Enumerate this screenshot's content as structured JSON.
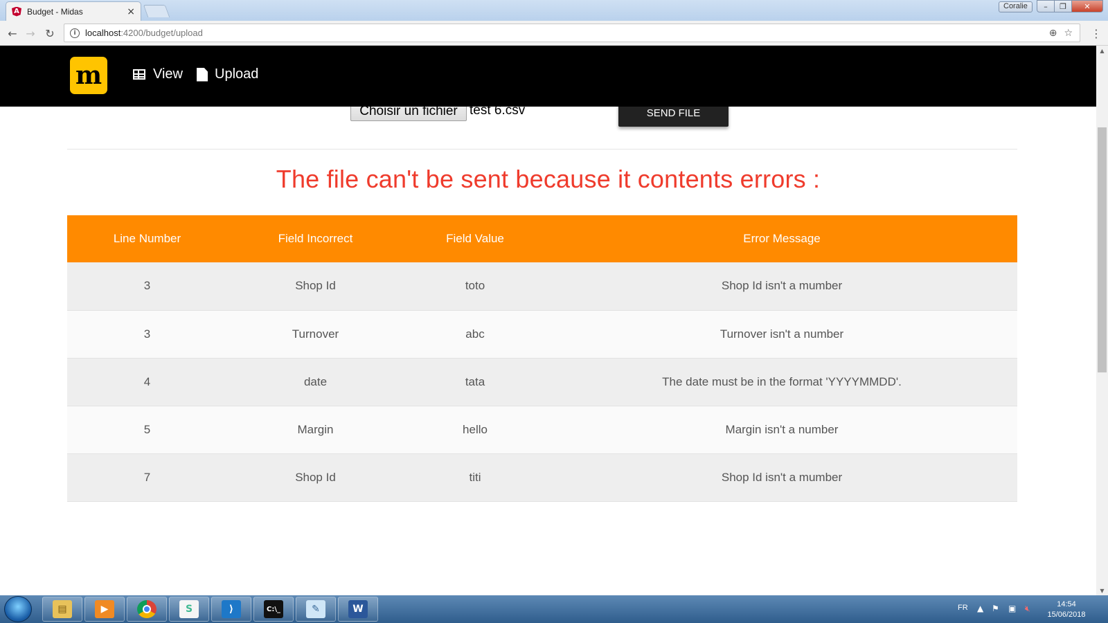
{
  "browser": {
    "tab_title": "Budget - Midas",
    "tab_favicon": "angular-icon",
    "tab_close": "×",
    "window_user": "Coralie",
    "url_host": "localhost",
    "url_path": ":4200/budget/upload",
    "back_glyph": "←",
    "forward_glyph": "→",
    "reload_glyph": "↻",
    "zoom_glyph": "⊕",
    "star_glyph": "☆",
    "menu_glyph": "⋮",
    "min_glyph": "–",
    "max_glyph": "❐",
    "close_glyph": "✕"
  },
  "navbar": {
    "logo_letter": "m",
    "view_label": "View",
    "upload_label": "Upload"
  },
  "upload": {
    "choose_file_label": "Choisir un fichier",
    "file_name": "test 6.csv",
    "send_label": "SEND FILE"
  },
  "error_title": "The file can't be sent because it contents errors :",
  "table": {
    "headers": [
      "Line Number",
      "Field Incorrect",
      "Field Value",
      "Error Message"
    ],
    "rows": [
      [
        "3",
        "Shop Id",
        "toto",
        "Shop Id isn't a mumber"
      ],
      [
        "3",
        "Turnover",
        "abc",
        "Turnover isn't a number"
      ],
      [
        "4",
        "date",
        "tata",
        "The date must be in the format 'YYYYMMDD'."
      ],
      [
        "5",
        "Margin",
        "hello",
        "Margin isn't a number"
      ],
      [
        "7",
        "Shop Id",
        "titi",
        "Shop Id isn't a mumber"
      ]
    ]
  },
  "colors": {
    "navbar_bg": "#000000",
    "brand_yellow": "#ffc400",
    "table_header": "#ff8a00",
    "error_text": "#ef3b2c",
    "send_button": "#222222"
  },
  "taskbar": {
    "apps": [
      "file-explorer-icon",
      "media-player-icon",
      "chrome-icon",
      "slack-icon",
      "vscode-icon",
      "terminal-icon",
      "notepad-icon",
      "word-icon"
    ],
    "language": "FR",
    "time": "14:54",
    "date": "15/06/2018"
  }
}
